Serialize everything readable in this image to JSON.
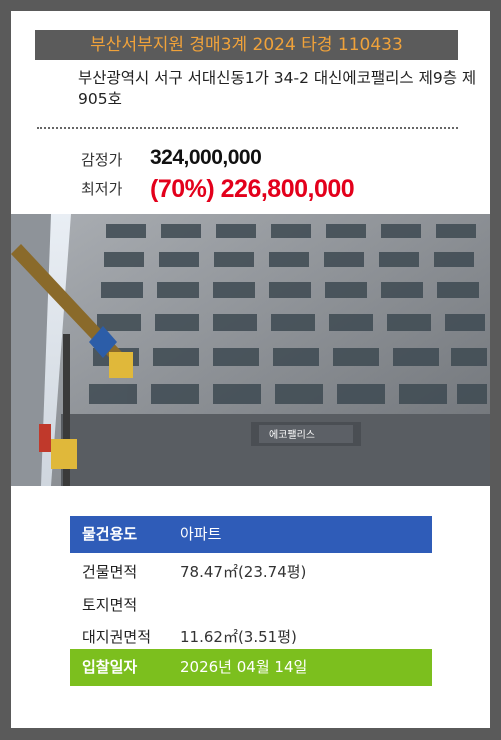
{
  "header": {
    "court_case": "부산서부지원 경매3계 2024 타경 110433"
  },
  "property": {
    "address": "부산광역시 서구 서대신동1가 34-2 대신에코팰리스 제9층 제905호",
    "building_sign": "에코팰리스"
  },
  "price": {
    "appraisal_label": "감정가",
    "appraisal_value": "324,000,000",
    "minimum_label": "최저가",
    "minimum_value": "(70%) 226,800,000"
  },
  "details": {
    "type_label": "물건용도",
    "type_value": "아파트",
    "building_area_label": "건물면적",
    "building_area_value": "78.47㎡(23.74평)",
    "land_area_label": "토지면적",
    "land_area_value": "",
    "land_right_label": "대지권면적",
    "land_right_value": "11.62㎡(3.51평)",
    "bid_date_label": "입찰일자",
    "bid_date_value": "2026년 04월 14일"
  },
  "colors": {
    "frame": "#5a5a5a",
    "header_bg": "#5b5b5b",
    "header_text": "#f0a23a",
    "minimum_price": "#e3001b",
    "type_row": "#2f5cb8",
    "bid_row": "#7cbf1e"
  }
}
